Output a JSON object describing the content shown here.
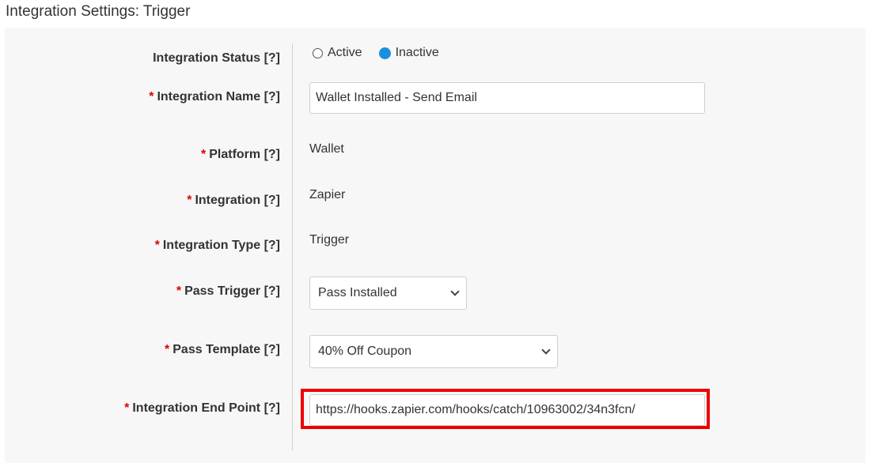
{
  "page_title": "Integration Settings: Trigger",
  "required_mark": "*",
  "fields": {
    "status": {
      "label": "Integration Status [?]",
      "options": [
        "Active",
        "Inactive"
      ],
      "selected": "Inactive"
    },
    "name": {
      "label": "Integration Name [?]",
      "value": "Wallet Installed - Send Email"
    },
    "platform": {
      "label": "Platform [?]",
      "value": "Wallet"
    },
    "integration": {
      "label": "Integration [?]",
      "value": "Zapier"
    },
    "type": {
      "label": "Integration Type [?]",
      "value": "Trigger"
    },
    "pass_trigger": {
      "label": "Pass Trigger [?]",
      "value": "Pass Installed"
    },
    "pass_template": {
      "label": "Pass Template [?]",
      "value": "40% Off Coupon"
    },
    "end_point": {
      "label": "Integration End Point [?]",
      "value": "https://hooks.zapier.com/hooks/catch/10963002/34n3fcn/"
    }
  },
  "colors": {
    "required": "#e00000",
    "radio_selected": "#1a8fe0",
    "highlight_border": "#ee0000"
  }
}
